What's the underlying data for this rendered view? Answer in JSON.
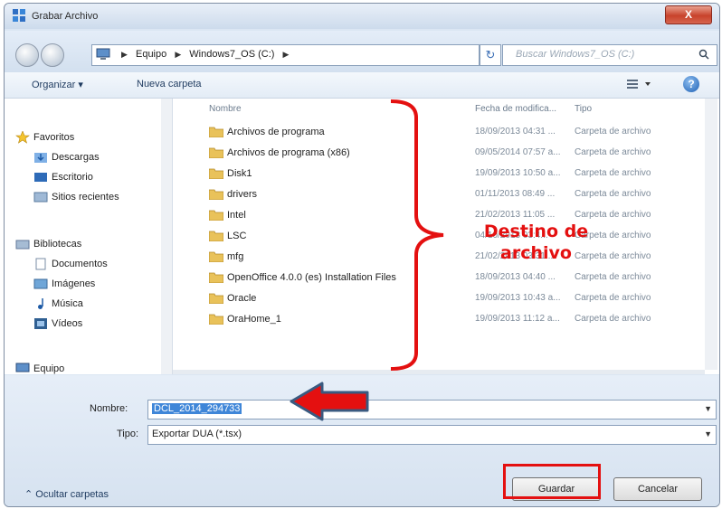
{
  "window": {
    "title": "Grabar Archivo",
    "close_label": "X"
  },
  "address": {
    "crumbs": [
      "Equipo",
      "Windows7_OS (C:)"
    ],
    "search_placeholder": "Buscar Windows7_OS (C:)"
  },
  "toolbar": {
    "organize_label": "Organizar ▾",
    "new_folder_label": "Nueva carpeta"
  },
  "nav": {
    "favorites": "Favoritos",
    "favorites_items": [
      "Descargas",
      "Escritorio",
      "Sitios recientes"
    ],
    "libraries": "Bibliotecas",
    "libraries_items": [
      "Documentos",
      "Imágenes",
      "Música",
      "Vídeos"
    ],
    "computer": "Equipo"
  },
  "files": {
    "columns": {
      "name": "Nombre",
      "date": "Fecha de modifica...",
      "type": "Tipo"
    },
    "rows": [
      {
        "name": "Archivos de programa",
        "date": "18/09/2013 04:31 ...",
        "type": "Carpeta de archivo"
      },
      {
        "name": "Archivos de programa (x86)",
        "date": "09/05/2014 07:57 a...",
        "type": "Carpeta de archivo"
      },
      {
        "name": "Disk1",
        "date": "19/09/2013 10:50 a...",
        "type": "Carpeta de archivo"
      },
      {
        "name": "drivers",
        "date": "01/11/2013 08:49 ...",
        "type": "Carpeta de archivo"
      },
      {
        "name": "Intel",
        "date": "21/02/2013 11:05 ...",
        "type": "Carpeta de archivo"
      },
      {
        "name": "LSC",
        "date": "04/10/2013 03:4...",
        "type": "Carpeta de archivo"
      },
      {
        "name": "mfg",
        "date": "21/02/2013 03:31 ...",
        "type": "Carpeta de archivo"
      },
      {
        "name": "OpenOffice 4.0.0 (es) Installation Files",
        "date": "18/09/2013 04:40 ...",
        "type": "Carpeta de archivo"
      },
      {
        "name": "Oracle",
        "date": "19/09/2013 10:43 a...",
        "type": "Carpeta de archivo"
      },
      {
        "name": "OraHome_1",
        "date": "19/09/2013 11:12 a...",
        "type": "Carpeta de archivo"
      }
    ]
  },
  "annotation": {
    "line1": "Destino de",
    "line2": "archivo",
    "color": "#e41010"
  },
  "form": {
    "name_label": "Nombre:",
    "name_value": "DCL_2014_294733",
    "type_label": "Tipo:",
    "type_value": "Exportar DUA (*.tsx)"
  },
  "footer": {
    "hide_folders": "Ocultar carpetas",
    "save_label": "Guardar",
    "cancel_label": "Cancelar"
  }
}
